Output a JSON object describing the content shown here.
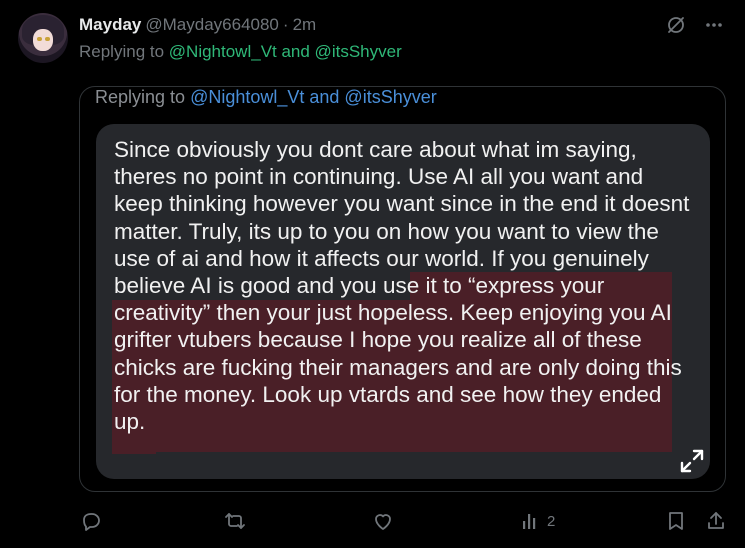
{
  "tweet": {
    "display_name": "Mayday",
    "handle": "@Mayday664080",
    "separator": "·",
    "time": "2m",
    "replying_prefix": "Replying to ",
    "replying_users": "@Nightowl_Vt and @itsShyver"
  },
  "quoted": {
    "replying_prefix": "Replying to ",
    "replying_users": "@Nightowl_Vt and @itsShyver",
    "text": "Since obviously you dont care about what im saying, theres no point in continuing. Use AI all you want and keep thinking however you want since in the end it doesnt matter. Truly, its up to you on how you want to view the use of ai and how it affects our world. If you genuinely believe AI is good and you use it to “express your creativity” then your just hopeless. Keep enjoying you AI grifter vtubers because I hope you realize all of these chicks are fucking their managers and are only doing this for the money. Look up vtards and see how they ended up."
  },
  "actions": {
    "views_count": "2"
  },
  "icons": [
    "grok-icon",
    "more-icon",
    "expand-icon",
    "reply-icon",
    "retweet-icon",
    "like-icon",
    "views-icon",
    "bookmark-icon",
    "share-icon"
  ],
  "colors": {
    "background": "#000000",
    "mention_green": "#2fb878",
    "mention_blue": "#4a8fd9",
    "bubble": "#26282c",
    "highlight": "#4a1f27",
    "muted": "#71767b"
  }
}
